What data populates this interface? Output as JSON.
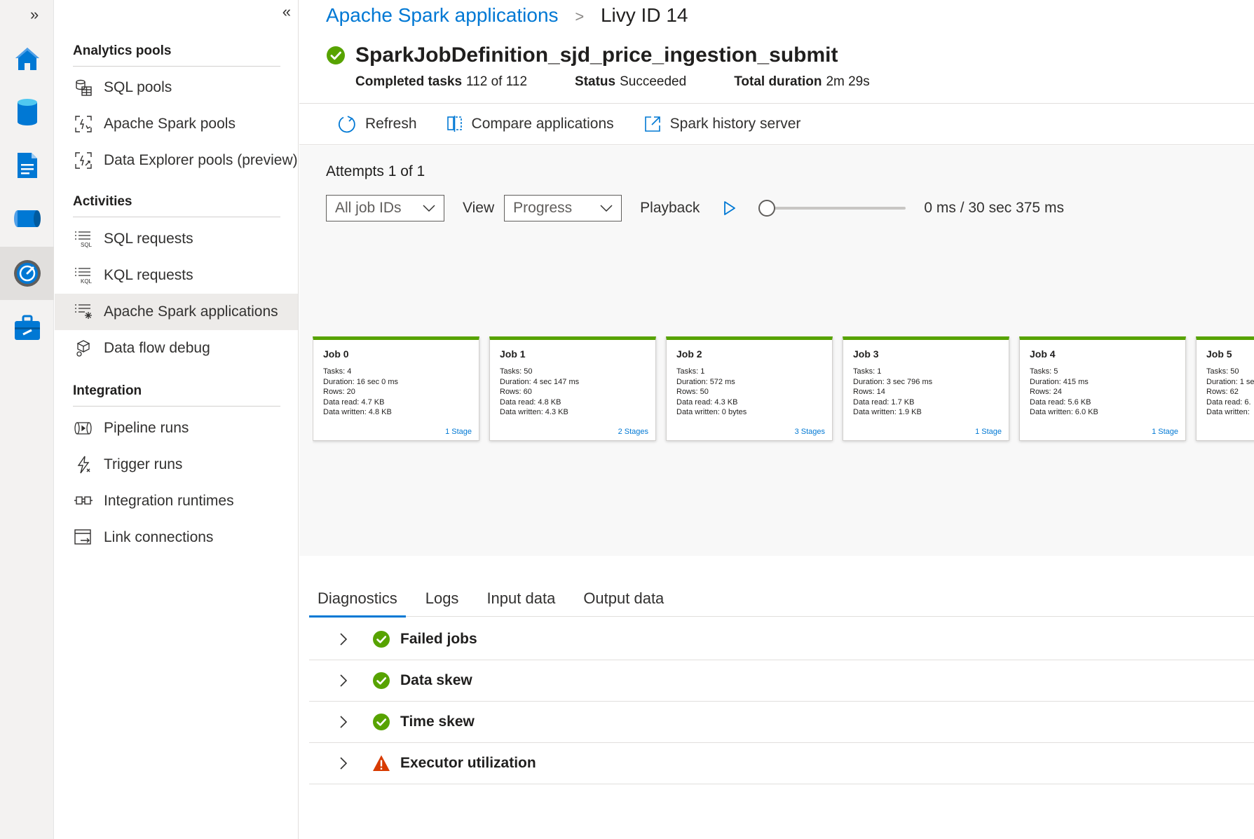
{
  "rail": {
    "expand_glyph": "»",
    "items": [
      {
        "icon": "home-icon",
        "color": "#0078d4"
      },
      {
        "icon": "database-icon",
        "color": "#0078d4"
      },
      {
        "icon": "document-icon",
        "color": "#0078d4"
      },
      {
        "icon": "pipeline-icon",
        "color": "#0078d4"
      },
      {
        "icon": "monitor-icon",
        "color": "#0078d4",
        "active": true
      },
      {
        "icon": "toolbox-icon",
        "color": "#0078d4"
      }
    ]
  },
  "nav": {
    "collapse_glyph": "«",
    "sections": [
      {
        "title": "Analytics pools",
        "items": [
          "SQL pools",
          "Apache Spark pools",
          "Data Explorer pools (preview)"
        ]
      },
      {
        "title": "Activities",
        "items": [
          "SQL requests",
          "KQL requests",
          "Apache Spark applications",
          "Data flow debug"
        ]
      },
      {
        "title": "Integration",
        "items": [
          "Pipeline runs",
          "Trigger runs",
          "Integration runtimes",
          "Link connections"
        ]
      }
    ],
    "active_item": "Apache Spark applications"
  },
  "breadcrumb": {
    "parent": "Apache Spark applications",
    "separator": ">",
    "current": "Livy ID 14"
  },
  "app": {
    "title": "SparkJobDefinition_sjd_price_ingestion_submit",
    "status_icon": "success-check-icon",
    "completed_label": "Completed tasks",
    "completed_value": "112 of 112",
    "status_label": "Status",
    "status_value": "Succeeded",
    "duration_label": "Total duration",
    "duration_value": "2m 29s"
  },
  "toolbar": {
    "refresh": "Refresh",
    "compare": "Compare applications",
    "history": "Spark history server"
  },
  "graph": {
    "attempts": "Attempts 1 of 1",
    "job_filter": "All job IDs",
    "view_label": "View",
    "view_value": "Progress",
    "playback_label": "Playback",
    "playback_progress": 0,
    "time_readout": "0 ms / 30 sec 375 ms",
    "jobs": [
      {
        "title": "Job 0",
        "lines": [
          "Tasks: 4",
          "Duration: 16 sec 0 ms",
          "Rows: 20",
          "Data read: 4.7 KB",
          "Data written: 4.8 KB"
        ],
        "stages": "1 Stage"
      },
      {
        "title": "Job 1",
        "lines": [
          "Tasks: 50",
          "Duration: 4 sec 147 ms",
          "Rows: 60",
          "Data read: 4.8 KB",
          "Data written: 4.3 KB"
        ],
        "stages": "2 Stages"
      },
      {
        "title": "Job 2",
        "lines": [
          "Tasks: 1",
          "Duration: 572 ms",
          "Rows: 50",
          "Data read: 4.3 KB",
          "Data written: 0 bytes"
        ],
        "stages": "3 Stages"
      },
      {
        "title": "Job 3",
        "lines": [
          "Tasks: 1",
          "Duration: 3 sec 796 ms",
          "Rows: 14",
          "Data read: 1.7 KB",
          "Data written: 1.9 KB"
        ],
        "stages": "1 Stage"
      },
      {
        "title": "Job 4",
        "lines": [
          "Tasks: 5",
          "Duration: 415 ms",
          "Rows: 24",
          "Data read: 5.6 KB",
          "Data written: 6.0 KB"
        ],
        "stages": "1 Stage"
      },
      {
        "title": "Job 5",
        "lines": [
          "Tasks: 50",
          "Duration: 1 se",
          "Rows: 62",
          "Data read: 6.",
          "Data written:"
        ],
        "stages": ""
      }
    ],
    "job_status_color": "#57a300"
  },
  "tabs": [
    "Diagnostics",
    "Logs",
    "Input data",
    "Output data"
  ],
  "active_tab": "Diagnostics",
  "diagnostics": [
    {
      "label": "Failed jobs",
      "status": "success"
    },
    {
      "label": "Data skew",
      "status": "success"
    },
    {
      "label": "Time skew",
      "status": "success"
    },
    {
      "label": "Executor utilization",
      "status": "warning"
    }
  ],
  "colors": {
    "accent": "#0078d4",
    "success": "#57a300",
    "warning": "#d83b01"
  }
}
